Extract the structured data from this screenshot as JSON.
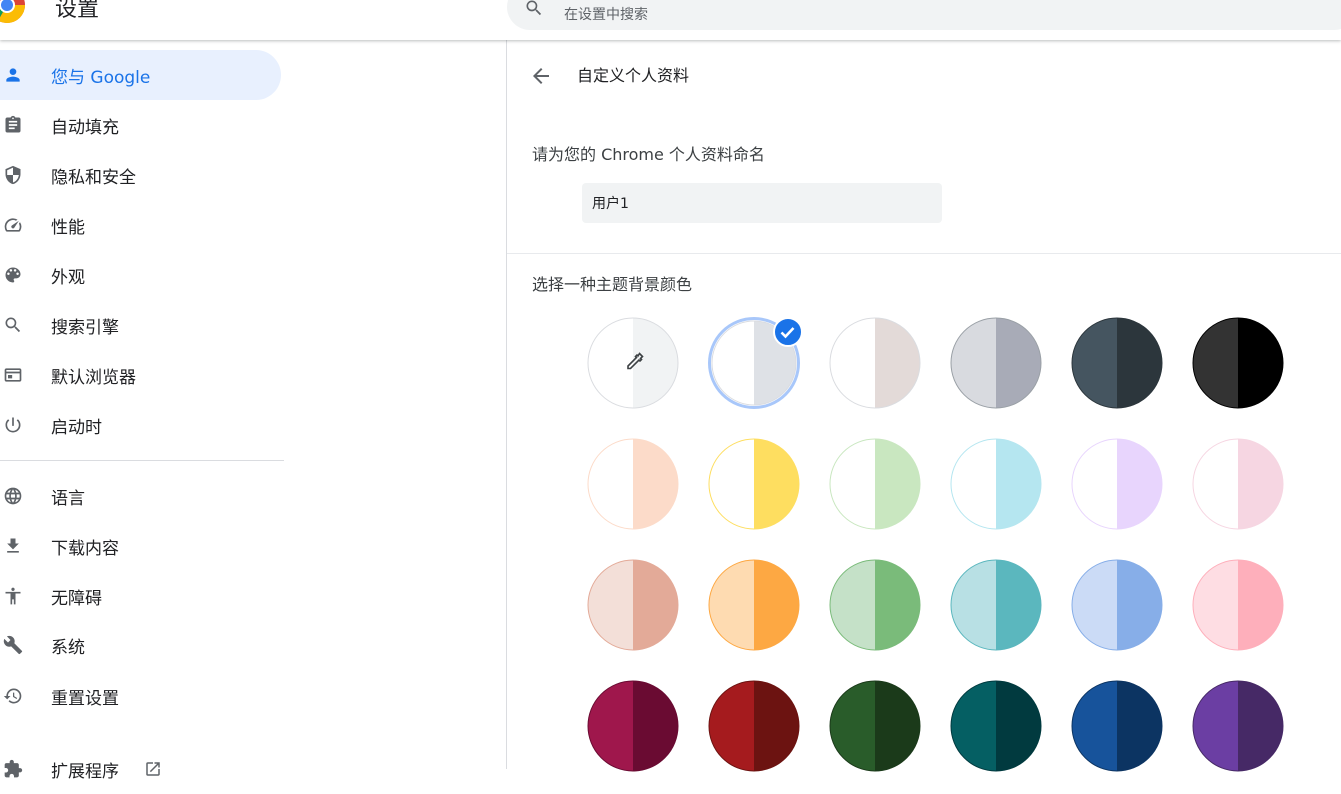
{
  "header": {
    "title": "设置",
    "search_placeholder": "在设置中搜索"
  },
  "sidebar": {
    "items": [
      {
        "label": "您与 Google",
        "icon": "person-icon",
        "active": true
      },
      {
        "label": "自动填充",
        "icon": "clipboard-icon"
      },
      {
        "label": "隐私和安全",
        "icon": "shield-icon"
      },
      {
        "label": "性能",
        "icon": "speedometer-icon"
      },
      {
        "label": "外观",
        "icon": "palette-icon"
      },
      {
        "label": "搜索引擎",
        "icon": "search-icon"
      },
      {
        "label": "默认浏览器",
        "icon": "browser-window-icon"
      },
      {
        "label": "启动时",
        "icon": "power-icon"
      },
      {
        "label": "语言",
        "icon": "globe-icon"
      },
      {
        "label": "下载内容",
        "icon": "download-icon"
      },
      {
        "label": "无障碍",
        "icon": "accessibility-icon"
      },
      {
        "label": "系统",
        "icon": "wrench-icon"
      },
      {
        "label": "重置设置",
        "icon": "history-icon"
      },
      {
        "label": "扩展程序",
        "icon": "puzzle-icon"
      }
    ]
  },
  "main": {
    "page_title": "自定义个人资料",
    "name_label": "请为您的 Chrome 个人资料命名",
    "name_value": "用户1",
    "color_label": "选择一种主题背景颜色",
    "selected_swatch": 1,
    "swatches": [
      {
        "left": "#ffffff",
        "right": "#f1f3f4",
        "border": "#dadce0",
        "picker": true
      },
      {
        "left": "#ffffff",
        "right": "#dee1e6",
        "border": "#dadce0"
      },
      {
        "left": "#ffffff",
        "right": "#e3dad8",
        "border": "#dadce0"
      },
      {
        "left": "#d8dadf",
        "right": "#a8abb7",
        "border": "#9aa0a6"
      },
      {
        "left": "#455560",
        "right": "#2c363c",
        "border": "#2c363c"
      },
      {
        "left": "#333333",
        "right": "#000000",
        "border": "#000000"
      },
      {
        "left": "#ffffff",
        "right": "#fcdbc9",
        "border": "#fcdbc9"
      },
      {
        "left": "#ffffff",
        "right": "#fede60",
        "border": "#fede60"
      },
      {
        "left": "#ffffff",
        "right": "#c9e7c0",
        "border": "#c9e7c0"
      },
      {
        "left": "#ffffff",
        "right": "#b5e6f0",
        "border": "#b5e6f0"
      },
      {
        "left": "#ffffff",
        "right": "#e8d5fd",
        "border": "#e8d5fd"
      },
      {
        "left": "#ffffff",
        "right": "#f6d6e2",
        "border": "#f6d6e2"
      },
      {
        "left": "#f3dfd8",
        "right": "#e3aa98",
        "border": "#e3aa98"
      },
      {
        "left": "#fedbb1",
        "right": "#fda843",
        "border": "#fda843"
      },
      {
        "left": "#c5e1c8",
        "right": "#7abb7a",
        "border": "#7abb7a"
      },
      {
        "left": "#b8e0e4",
        "right": "#5bb7be",
        "border": "#5bb7be"
      },
      {
        "left": "#cbdbf6",
        "right": "#87aee8",
        "border": "#87aee8"
      },
      {
        "left": "#fedde3",
        "right": "#feafbb",
        "border": "#feafbb"
      },
      {
        "left": "#9f174c",
        "right": "#6a0b32",
        "border": "#6a0b32"
      },
      {
        "left": "#a51b1e",
        "right": "#6c1311",
        "border": "#6c1311"
      },
      {
        "left": "#295c2a",
        "right": "#1b3a1a",
        "border": "#1b3a1a"
      },
      {
        "left": "#055f63",
        "right": "#013a3f",
        "border": "#013a3f"
      },
      {
        "left": "#17539b",
        "right": "#0c3462",
        "border": "#0c3462"
      },
      {
        "left": "#6b3ea3",
        "right": "#462966",
        "border": "#462966"
      }
    ]
  },
  "colors": {
    "accent": "#1a73e8",
    "active_bg": "#e8f0fe"
  }
}
